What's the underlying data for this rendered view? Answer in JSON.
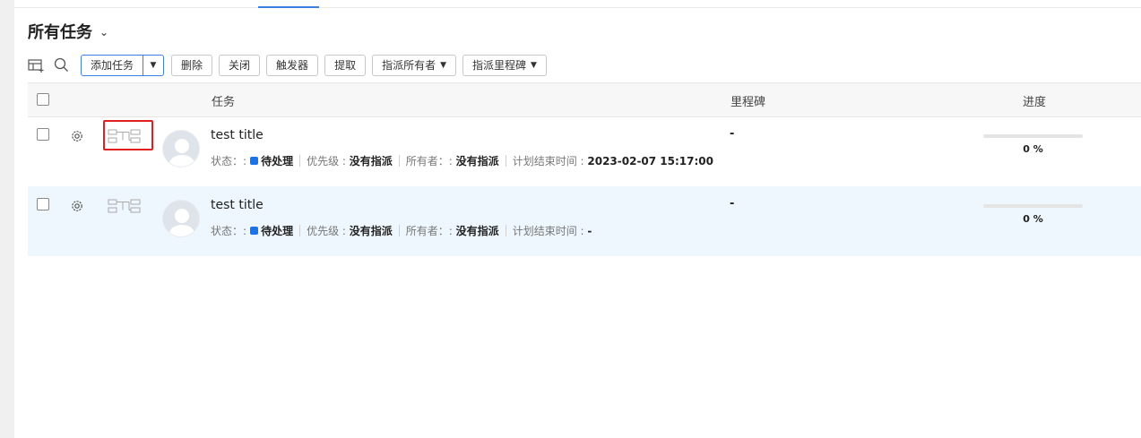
{
  "header": {
    "title": "所有任务"
  },
  "toolbar": {
    "add_task": "添加任务",
    "delete": "删除",
    "close": "关闭",
    "trigger": "触发器",
    "extract": "提取",
    "assign_owner": "指派所有者",
    "assign_milestone": "指派里程碑"
  },
  "table": {
    "columns": {
      "task": "任务",
      "milestone": "里程碑",
      "progress": "进度"
    },
    "rows": [
      {
        "title": "test title",
        "status_label": "状态：",
        "status_sep": ":",
        "status": "待处理",
        "status_color": "#1a73e8",
        "priority_label": "优先级 :",
        "priority": "没有指派",
        "owner_label": "所有者：",
        "owner_sep": ":",
        "owner": "没有指派",
        "due_label": "计划结束时间 :",
        "due": "2023-02-07 15:17:00",
        "milestone": "-",
        "progress": 0,
        "progress_text": "0 %"
      },
      {
        "title": "test title",
        "status_label": "状态：",
        "status_sep": ":",
        "status": "待处理",
        "status_color": "#1a73e8",
        "priority_label": "优先级 :",
        "priority": "没有指派",
        "owner_label": "所有者：",
        "owner_sep": ":",
        "owner": "没有指派",
        "due_label": "计划结束时间 :",
        "due": "-",
        "milestone": "-",
        "progress": 0,
        "progress_text": "0 %"
      }
    ]
  },
  "colors": {
    "accent": "#3d7fe0",
    "highlight": "#e02020",
    "row_alt": "#eef7fd"
  }
}
